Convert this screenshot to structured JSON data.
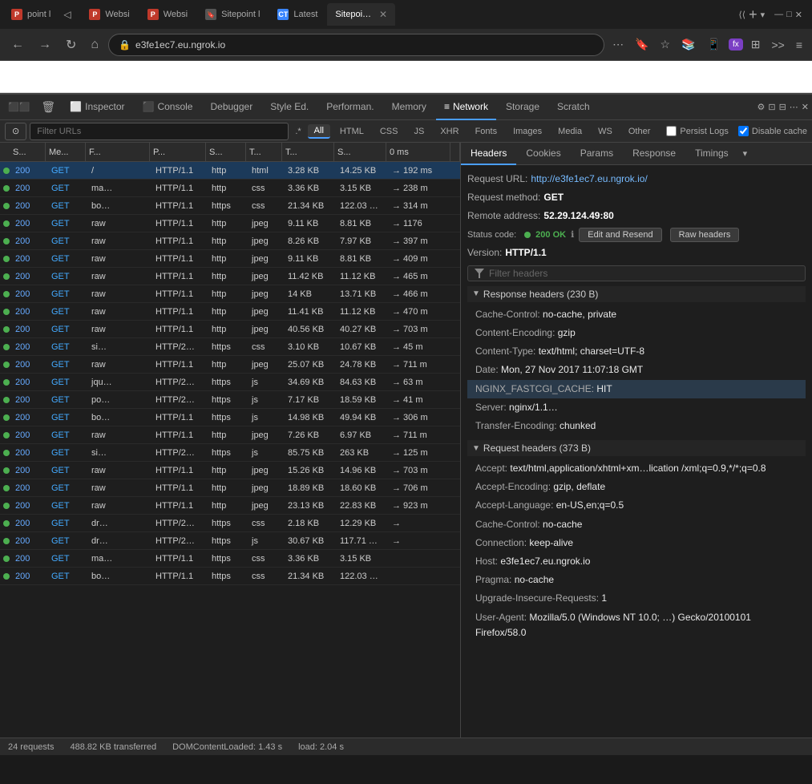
{
  "browser": {
    "tabs": [
      {
        "id": 1,
        "icon": "P",
        "icon_color": "red",
        "label": "point l",
        "active": false
      },
      {
        "id": 2,
        "icon": "◁",
        "icon_color": "none",
        "label": "",
        "active": false
      },
      {
        "id": 3,
        "icon": "P",
        "icon_color": "red",
        "label": "Websi",
        "active": false
      },
      {
        "id": 4,
        "icon": "P",
        "icon_color": "red",
        "label": "Websi",
        "active": false
      },
      {
        "id": 5,
        "icon": "🔖",
        "icon_color": "none",
        "label": "Sitepoint l",
        "active": false
      },
      {
        "id": 6,
        "icon": "CT",
        "icon_color": "blue",
        "label": "Latest",
        "active": false
      },
      {
        "id": 7,
        "icon": "",
        "icon_color": "none",
        "label": "Sitepoi…",
        "active": true,
        "closeable": true
      }
    ],
    "address": "e3fe1ec7.eu.ngrok.io"
  },
  "devtools": {
    "tabs": [
      {
        "label": "Inspector",
        "icon": "⬜"
      },
      {
        "label": "Console",
        "icon": "⬛"
      },
      {
        "label": "Debugger",
        "icon": ""
      },
      {
        "label": "Style Ed.",
        "icon": "{}"
      },
      {
        "label": "Performan.",
        "icon": "⏱"
      },
      {
        "label": "Memory",
        "icon": "📊"
      },
      {
        "label": "Network",
        "icon": "≡",
        "active": true
      },
      {
        "label": "Storage",
        "icon": "🗄"
      },
      {
        "label": "Scratch",
        "icon": ""
      }
    ],
    "network_filters": [
      {
        "label": "All",
        "active": true
      },
      {
        "label": "HTML",
        "active": false
      },
      {
        "label": "CSS",
        "active": false
      },
      {
        "label": "JS",
        "active": false
      },
      {
        "label": "XHR",
        "active": false
      },
      {
        "label": "Fonts",
        "active": false
      },
      {
        "label": "Images",
        "active": false
      },
      {
        "label": "Media",
        "active": false
      },
      {
        "label": "WS",
        "active": false
      },
      {
        "label": "Other",
        "active": false
      }
    ],
    "persist_cache": {
      "persist_label": "Persist Logs",
      "disable_cache": "Disable cache"
    },
    "filter_placeholder": "Filter URLs"
  },
  "request_table": {
    "headers": [
      "S...",
      "Me...",
      "F...",
      "P...",
      "S...",
      "T...",
      "T...",
      "S...",
      "0 ms"
    ],
    "rows": [
      {
        "status": "200",
        "method": "GET",
        "file": "/",
        "proto": "HTTP/1.1",
        "scheme": "http",
        "type": "html",
        "trans": "3.28 KB",
        "size": "14.25 KB",
        "time": "→ 192 ms",
        "selected": true
      },
      {
        "status": "200",
        "method": "GET",
        "file": "ma…",
        "proto": "HTTP/1.1",
        "scheme": "http",
        "type": "css",
        "trans": "3.36 KB",
        "size": "3.15 KB",
        "time": "→ 238 m"
      },
      {
        "status": "200",
        "method": "GET",
        "file": "bo…",
        "proto": "HTTP/1.1",
        "scheme": "https",
        "type": "css",
        "trans": "21.34 KB",
        "size": "122.03 …",
        "time": "→ 314 m"
      },
      {
        "status": "200",
        "method": "GET",
        "file": "raw",
        "proto": "HTTP/1.1",
        "scheme": "http",
        "type": "jpeg",
        "trans": "9.11 KB",
        "size": "8.81 KB",
        "time": "→ 1176"
      },
      {
        "status": "200",
        "method": "GET",
        "file": "raw",
        "proto": "HTTP/1.1",
        "scheme": "http",
        "type": "jpeg",
        "trans": "8.26 KB",
        "size": "7.97 KB",
        "time": "→ 397 m"
      },
      {
        "status": "200",
        "method": "GET",
        "file": "raw",
        "proto": "HTTP/1.1",
        "scheme": "http",
        "type": "jpeg",
        "trans": "9.11 KB",
        "size": "8.81 KB",
        "time": "→ 409 m"
      },
      {
        "status": "200",
        "method": "GET",
        "file": "raw",
        "proto": "HTTP/1.1",
        "scheme": "http",
        "type": "jpeg",
        "trans": "11.42 KB",
        "size": "11.12 KB",
        "time": "→ 465 m"
      },
      {
        "status": "200",
        "method": "GET",
        "file": "raw",
        "proto": "HTTP/1.1",
        "scheme": "http",
        "type": "jpeg",
        "trans": "14 KB",
        "size": "13.71 KB",
        "time": "→ 466 m"
      },
      {
        "status": "200",
        "method": "GET",
        "file": "raw",
        "proto": "HTTP/1.1",
        "scheme": "http",
        "type": "jpeg",
        "trans": "11.41 KB",
        "size": "11.12 KB",
        "time": "→ 470 m"
      },
      {
        "status": "200",
        "method": "GET",
        "file": "raw",
        "proto": "HTTP/1.1",
        "scheme": "http",
        "type": "jpeg",
        "trans": "40.56 KB",
        "size": "40.27 KB",
        "time": "→ 703 m"
      },
      {
        "status": "200",
        "method": "GET",
        "file": "si…",
        "proto": "HTTP/2…",
        "scheme": "https",
        "type": "css",
        "trans": "3.10 KB",
        "size": "10.67 KB",
        "time": "→ 45 m"
      },
      {
        "status": "200",
        "method": "GET",
        "file": "raw",
        "proto": "HTTP/1.1",
        "scheme": "http",
        "type": "jpeg",
        "trans": "25.07 KB",
        "size": "24.78 KB",
        "time": "→ 711 m"
      },
      {
        "status": "200",
        "method": "GET",
        "file": "jqu…",
        "proto": "HTTP/2…",
        "scheme": "https",
        "type": "js",
        "trans": "34.69 KB",
        "size": "84.63 KB",
        "time": "→ 63 m"
      },
      {
        "status": "200",
        "method": "GET",
        "file": "po…",
        "proto": "HTTP/2…",
        "scheme": "https",
        "type": "js",
        "trans": "7.17 KB",
        "size": "18.59 KB",
        "time": "→ 41 m"
      },
      {
        "status": "200",
        "method": "GET",
        "file": "bo…",
        "proto": "HTTP/1.1",
        "scheme": "https",
        "type": "js",
        "trans": "14.98 KB",
        "size": "49.94 KB",
        "time": "→ 306 m"
      },
      {
        "status": "200",
        "method": "GET",
        "file": "raw",
        "proto": "HTTP/1.1",
        "scheme": "http",
        "type": "jpeg",
        "trans": "7.26 KB",
        "size": "6.97 KB",
        "time": "→ 711 m"
      },
      {
        "status": "200",
        "method": "GET",
        "file": "si…",
        "proto": "HTTP/2…",
        "scheme": "https",
        "type": "js",
        "trans": "85.75 KB",
        "size": "263 KB",
        "time": "→ 125 m"
      },
      {
        "status": "200",
        "method": "GET",
        "file": "raw",
        "proto": "HTTP/1.1",
        "scheme": "http",
        "type": "jpeg",
        "trans": "15.26 KB",
        "size": "14.96 KB",
        "time": "→ 703 m"
      },
      {
        "status": "200",
        "method": "GET",
        "file": "raw",
        "proto": "HTTP/1.1",
        "scheme": "http",
        "type": "jpeg",
        "trans": "18.89 KB",
        "size": "18.60 KB",
        "time": "→ 706 m"
      },
      {
        "status": "200",
        "method": "GET",
        "file": "raw",
        "proto": "HTTP/1.1",
        "scheme": "http",
        "type": "jpeg",
        "trans": "23.13 KB",
        "size": "22.83 KB",
        "time": "→ 923 m"
      },
      {
        "status": "200",
        "method": "GET",
        "file": "dr…",
        "proto": "HTTP/2…",
        "scheme": "https",
        "type": "css",
        "trans": "2.18 KB",
        "size": "12.29 KB",
        "time": "→ "
      },
      {
        "status": "200",
        "method": "GET",
        "file": "dr…",
        "proto": "HTTP/2…",
        "scheme": "https",
        "type": "js",
        "trans": "30.67 KB",
        "size": "117.71 …",
        "time": "→ "
      },
      {
        "status": "200",
        "method": "GET",
        "file": "ma…",
        "proto": "HTTP/1.1",
        "scheme": "https",
        "type": "css",
        "trans": "3.36 KB",
        "size": "3.15 KB",
        "time": ""
      },
      {
        "status": "200",
        "method": "GET",
        "file": "bo…",
        "proto": "HTTP/1.1",
        "scheme": "https",
        "type": "css",
        "trans": "21.34 KB",
        "size": "122.03 …",
        "time": ""
      }
    ]
  },
  "details": {
    "tabs": [
      {
        "label": "Headers",
        "active": true
      },
      {
        "label": "Cookies",
        "active": false
      },
      {
        "label": "Params",
        "active": false
      },
      {
        "label": "Response",
        "active": false
      },
      {
        "label": "Timings",
        "active": false
      }
    ],
    "request_url_label": "Request URL:",
    "request_url_value": "http://e3fe1ec7.eu.ngrok.io/",
    "request_method_label": "Request method:",
    "request_method_value": "GET",
    "remote_address_label": "Remote address:",
    "remote_address_value": "52.29.124.49:80",
    "status_code_label": "Status code:",
    "status_code_value": "200 OK",
    "version_label": "Version:",
    "version_value": "HTTP/1.1",
    "edit_resend_btn": "Edit and Resend",
    "raw_headers_btn": "Raw headers",
    "filter_placeholder": "Filter headers",
    "response_headers_section": "Response headers (230 B)",
    "response_headers": [
      {
        "name": "Cache-Control:",
        "value": "no-cache, private"
      },
      {
        "name": "Content-Encoding:",
        "value": "gzip"
      },
      {
        "name": "Content-Type:",
        "value": "text/html; charset=UTF-8"
      },
      {
        "name": "Date:",
        "value": "Mon, 27 Nov 2017 11:07:18 GMT"
      },
      {
        "name": "NGINX_FASTCGI_CACHE:",
        "value": "HIT"
      },
      {
        "name": "Server:",
        "value": "nginx/1.1…"
      },
      {
        "name": "Transfer-Encoding:",
        "value": "chunked"
      }
    ],
    "request_headers_section": "Request headers (373 B)",
    "request_headers": [
      {
        "name": "Accept:",
        "value": "text/html,application/xhtml+xm…lication\n/xml;q=0.9,*/*;q=0.8"
      },
      {
        "name": "Accept-Encoding:",
        "value": "gzip, deflate"
      },
      {
        "name": "Accept-Language:",
        "value": "en-US,en;q=0.5"
      },
      {
        "name": "Cache-Control:",
        "value": "no-cache"
      },
      {
        "name": "Connection:",
        "value": "keep-alive"
      },
      {
        "name": "Host:",
        "value": "e3fe1ec7.eu.ngrok.io"
      },
      {
        "name": "Pragma:",
        "value": "no-cache"
      },
      {
        "name": "Upgrade-Insecure-Requests:",
        "value": "1"
      },
      {
        "name": "User-Agent:",
        "value": "Mozilla/5.0 (Windows NT 10.0; …)\nGecko/20100101 Firefox/58.0"
      }
    ]
  }
}
